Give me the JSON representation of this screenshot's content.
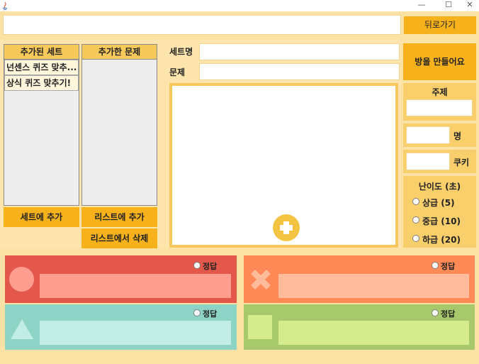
{
  "window": {
    "minimize": "—",
    "maximize": "☐",
    "close": "✕"
  },
  "toolbar": {
    "search_value": "",
    "back_label": "뒤로가기"
  },
  "sets_panel": {
    "header": "추가된 세트",
    "items": [
      "넌센스 퀴즈 맞추...",
      "상식 퀴즈 맞추기!"
    ],
    "add_to_set_label": "세트에 추가"
  },
  "questions_panel": {
    "header": "추가한 문제",
    "items": [],
    "add_to_list_label": "리스트에 추가",
    "delete_from_list_label": "리스트에서 삭제"
  },
  "editor": {
    "set_name_label": "세트명",
    "set_name_value": "",
    "question_label": "문제",
    "question_value": "",
    "add_image_icon": "plus-icon"
  },
  "room": {
    "make_room_label": "방을 만들어요",
    "topic_label": "주제",
    "topic_value": "",
    "people_value": "",
    "people_unit": "명",
    "cookie_value": "",
    "cookie_unit": "쿠키",
    "difficulty_label": "난이도 (초)",
    "difficulties": [
      "상급 (5)",
      "중급 (10)",
      "하급 (20)"
    ]
  },
  "answers": [
    {
      "shape": "circle",
      "correct_label": "정답",
      "value": "",
      "color": "#e3584a",
      "input_color": "#ff9d8f",
      "shape_color": "#ff9d8f"
    },
    {
      "shape": "cross",
      "correct_label": "정답",
      "value": "",
      "color": "#ff8a57",
      "input_color": "#ffbb9b",
      "shape_color": "#ffbb9b"
    },
    {
      "shape": "triangle",
      "correct_label": "정답",
      "value": "",
      "color": "#8dd3c6",
      "input_color": "#c2ede6",
      "shape_color": "#c2ede6"
    },
    {
      "shape": "square",
      "correct_label": "정답",
      "value": "",
      "color": "#a8c96b",
      "input_color": "#d6ec8c",
      "shape_color": "#d6ec8c"
    }
  ]
}
